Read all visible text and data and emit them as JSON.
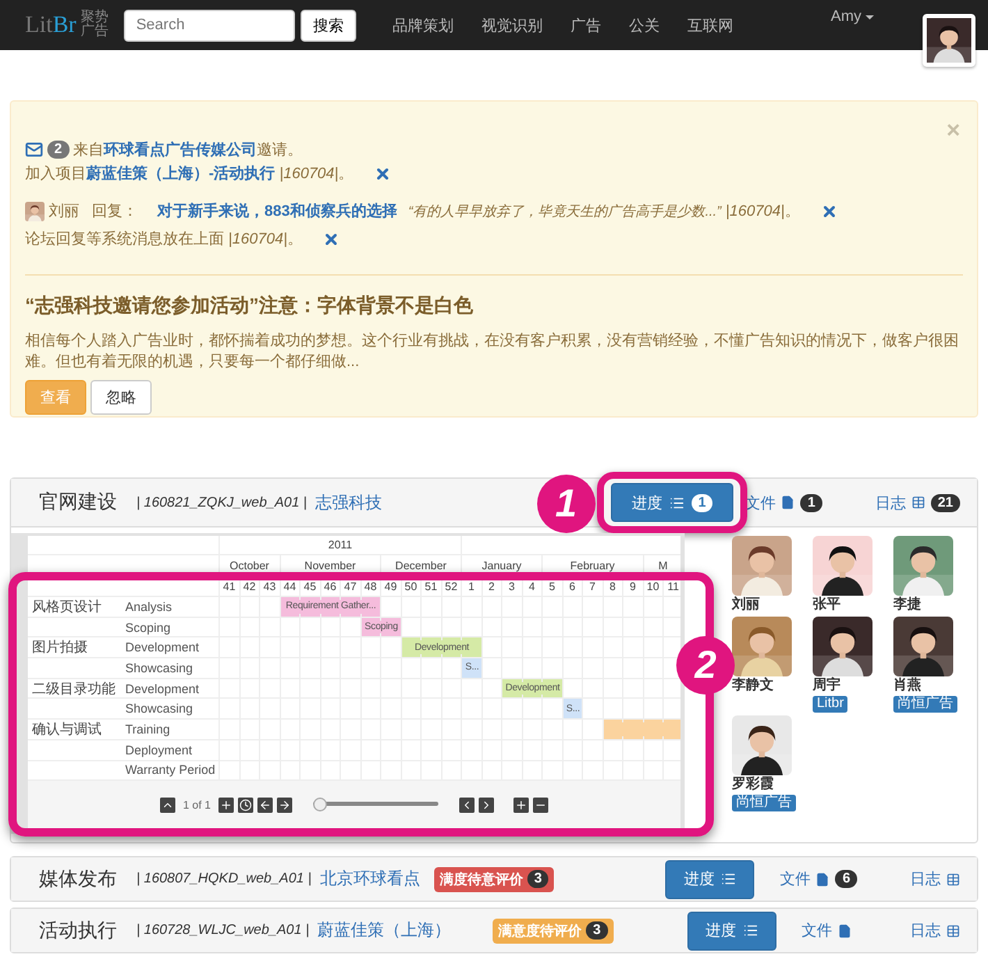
{
  "navbar": {
    "logo": {
      "text": "Lit",
      "accent": "Br",
      "tagline": "聚势广告"
    },
    "search": {
      "placeholder": "Search",
      "button": "搜索"
    },
    "links": [
      "品牌策划",
      "视觉识别",
      "广告",
      "公关",
      "互联网"
    ],
    "user": "Amy"
  },
  "alert": {
    "close": "×",
    "notifications": [
      {
        "kind": "invite",
        "count": "2",
        "dismissible": false,
        "parts": [
          {
            "kind": "text",
            "text": "来自"
          },
          {
            "kind": "link",
            "text": "环球看点广告传媒公司"
          },
          {
            "kind": "text",
            "text": "邀请。"
          }
        ]
      },
      {
        "kind": "plain",
        "dismissible": true,
        "parts": [
          {
            "kind": "text",
            "text": "加入项目"
          },
          {
            "kind": "link",
            "text": "蔚蓝佳策（上海）-活动执行"
          },
          {
            "kind": "ref",
            "text": " |160704|"
          },
          {
            "kind": "text",
            "text": "。"
          }
        ]
      },
      {
        "kind": "reply",
        "name": "刘丽",
        "dismissible": true,
        "parts": [
          {
            "kind": "text",
            "text": "回复："
          },
          {
            "kind": "link",
            "text": "对于新手来说，883和侦察兵的选择"
          },
          {
            "kind": "ref",
            "text": "“有的人早早放弃了，毕竟天生的广告高手是少数...”"
          },
          {
            "kind": "ref",
            "text": " |160704|"
          },
          {
            "kind": "text",
            "text": "。"
          }
        ]
      },
      {
        "kind": "plain",
        "dismissible": true,
        "parts": [
          {
            "kind": "text",
            "text": "论坛回复等系统消息放在上面"
          },
          {
            "kind": "ref",
            "text": " |160704|"
          },
          {
            "kind": "text",
            "text": "。"
          }
        ]
      }
    ],
    "title": "“志强科技邀请您参加活动”注意：字体背景不是白色",
    "body": "相信每个人踏入广告业时，都怀揣着成功的梦想。这个行业有挑战，在没有客户积累，没有营销经验，不懂广告知识的情况下，做客户很困难。但也有着无限的机遇，只要每一个都仔细做...",
    "buttons": [
      {
        "label": "查看",
        "kind": "primary"
      },
      {
        "label": "忽略",
        "kind": "default"
      }
    ]
  },
  "projects": [
    {
      "title": "官网建设",
      "code": "| 160821_ZQKJ_web_A01 |",
      "client": "志强科技",
      "expanded": true,
      "progress": {
        "label": "进度",
        "count": "1",
        "callout": "1"
      },
      "files": {
        "label": "文件",
        "count": "1"
      },
      "log": {
        "label": "日志",
        "count": "21"
      },
      "gantt": {
        "callout": "2",
        "page": "1 of 1",
        "slider": {
          "level": 0
        },
        "years": [
          {
            "label": "2011",
            "months": [
              {
                "label": "October",
                "weeks": [
                  "41",
                  "42",
                  "43"
                ]
              },
              {
                "label": "November",
                "weeks": [
                  "44",
                  "45",
                  "46",
                  "47",
                  "48"
                ]
              },
              {
                "label": "December",
                "weeks": [
                  "49",
                  "50",
                  "51",
                  "52"
                ]
              }
            ]
          },
          {
            "months": [
              {
                "label": "January",
                "weeks": [
                  "1",
                  "2",
                  "3",
                  "4"
                ]
              },
              {
                "label": "February",
                "weeks": [
                  "5",
                  "6",
                  "7",
                  "8",
                  "9"
                ]
              },
              {
                "label": "M",
                "weeks": [
                  "10",
                  "11"
                ]
              }
            ]
          }
        ],
        "rows": [
          {
            "group": "风格页设计",
            "task": "Analysis",
            "bar": {
              "label": "Requirement Gather...",
              "color": "#f5bcdc"
            },
            "cells": [
              false,
              false,
              false,
              true,
              true,
              true,
              true,
              true,
              false,
              false,
              false,
              false,
              false,
              false,
              false,
              false,
              false,
              false,
              false,
              false,
              false,
              false,
              false
            ]
          },
          {
            "task": "Scoping",
            "bar": {
              "label": "Scoping",
              "color": "#f5bcdc"
            },
            "cells": [
              false,
              false,
              false,
              false,
              false,
              false,
              false,
              true,
              true,
              false,
              false,
              false,
              false,
              false,
              false,
              false,
              false,
              false,
              false,
              false,
              false,
              false,
              false
            ]
          },
          {
            "group": "图片拍摄",
            "task": "Development",
            "bar": {
              "label": "Development",
              "color": "#d5eaa6"
            },
            "cells": [
              false,
              false,
              false,
              false,
              false,
              false,
              false,
              false,
              false,
              true,
              true,
              true,
              true,
              false,
              false,
              false,
              false,
              false,
              false,
              false,
              false,
              false,
              false
            ]
          },
          {
            "task": "Showcasing",
            "bar": {
              "label": "S...",
              "color": "#cfe2f8"
            },
            "cells": [
              false,
              false,
              false,
              false,
              false,
              false,
              false,
              false,
              false,
              false,
              false,
              false,
              true,
              false,
              false,
              false,
              false,
              false,
              false,
              false,
              false,
              false,
              false
            ]
          },
          {
            "group": "二级目录功能",
            "task": "Development",
            "bar": {
              "label": "Development",
              "color": "#d5eaa6"
            },
            "cells": [
              false,
              false,
              false,
              false,
              false,
              false,
              false,
              false,
              false,
              false,
              false,
              false,
              false,
              false,
              true,
              true,
              true,
              false,
              false,
              false,
              false,
              false,
              false
            ]
          },
          {
            "task": "Showcasing",
            "bar": {
              "label": "S...",
              "color": "#cfe2f8"
            },
            "cells": [
              false,
              false,
              false,
              false,
              false,
              false,
              false,
              false,
              false,
              false,
              false,
              false,
              false,
              false,
              false,
              false,
              false,
              true,
              false,
              false,
              false,
              false,
              false
            ]
          },
          {
            "group": "确认与调试",
            "task": "Training",
            "bar": {
              "color": "#fbd39e"
            },
            "cells": [
              false,
              false,
              false,
              false,
              false,
              false,
              false,
              false,
              false,
              false,
              false,
              false,
              false,
              false,
              false,
              false,
              false,
              false,
              false,
              true,
              true,
              true,
              true
            ]
          },
          {
            "task": "Deployment"
          },
          {
            "task": "Warranty Period"
          }
        ]
      },
      "members": [
        {
          "name": "刘丽"
        },
        {
          "name": "张平"
        },
        {
          "name": "李捷"
        },
        {
          "name": "李静文"
        },
        {
          "name": "周宇",
          "badge": "Litbr"
        },
        {
          "name": "肖燕",
          "badge": "尚恒广告"
        },
        {
          "name": "罗彩霞",
          "badge": "尚恒广告"
        }
      ]
    },
    {
      "title": "媒体发布",
      "code": "| 160807_HQKD_web_A01 |",
      "client": "北京环球看点",
      "expanded": false,
      "rating": {
        "label": "满度待意评价",
        "count": "3",
        "kind": "danger"
      },
      "progress": {
        "label": "进度"
      },
      "files": {
        "label": "文件",
        "count": "6"
      },
      "log": {
        "label": "日志"
      }
    },
    {
      "title": "活动执行",
      "code": "| 160728_WLJC_web_A01 |",
      "client": "蔚蓝佳策（上海）",
      "expanded": false,
      "rating": {
        "label": "满意度待评价",
        "count": "3",
        "kind": "warning"
      },
      "progress": {
        "label": "进度"
      },
      "files": {
        "label": "文件"
      },
      "log": {
        "label": "日志"
      }
    }
  ]
}
